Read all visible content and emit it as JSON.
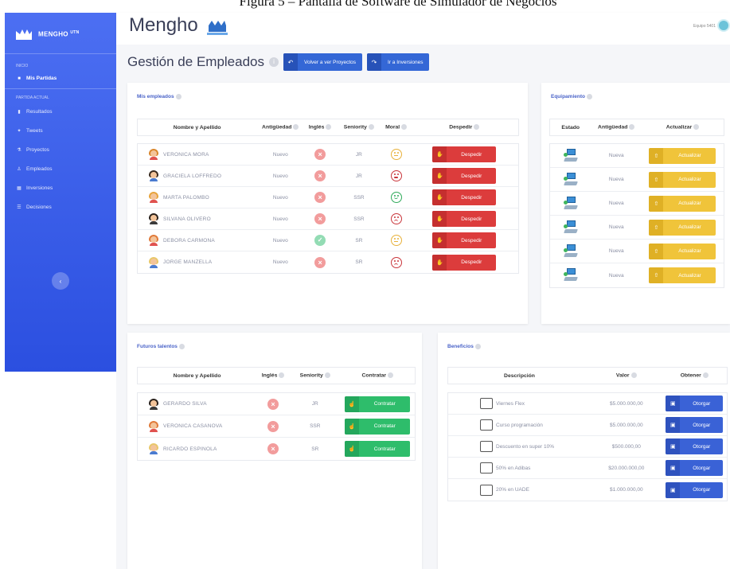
{
  "caption": "Figura 5 – Pantalla de Software de Simulador de Negocios",
  "sidebar": {
    "brand": "MENGHO",
    "brand_sup": "UTN",
    "section_inicio": "INICIO",
    "mis_partidas": "Mis Partidas",
    "section_partida": "PARTIDA ACTUAL",
    "items": [
      {
        "label": "Resultados",
        "icon": "chart-icon"
      },
      {
        "label": "Tweets",
        "icon": "twitter-icon"
      },
      {
        "label": "Proyectos",
        "icon": "flask-icon"
      },
      {
        "label": "Empleados",
        "icon": "user-icon"
      },
      {
        "label": "Inversiones",
        "icon": "grid-icon"
      },
      {
        "label": "Decisiones",
        "icon": "list-icon"
      }
    ]
  },
  "topbar": {
    "title": "Mengho",
    "user": "Equipo 5401"
  },
  "page": {
    "title": "Gestión de Empleados",
    "btn_back": "Volver a ver Proyectos",
    "btn_invest": "Ir a Inversiones"
  },
  "empleados": {
    "title": "Mis empleados",
    "headers": [
      "Nombre y Apellido",
      "Antigüedad",
      "Inglés",
      "Seniority",
      "Moral",
      "Despedir"
    ],
    "action_label": "Despedir",
    "rows": [
      {
        "name": "VERONICA MORA",
        "antiguedad": "Nuevo",
        "ingles": false,
        "seniority": "JR",
        "moral": "neutral"
      },
      {
        "name": "GRACIELA LOFFREDO",
        "antiguedad": "Nuevo",
        "ingles": false,
        "seniority": "JR",
        "moral": "angry"
      },
      {
        "name": "MARTA PALOMBO",
        "antiguedad": "Nuevo",
        "ingles": false,
        "seniority": "SSR",
        "moral": "happy"
      },
      {
        "name": "SILVANA OLIVERO",
        "antiguedad": "Nuevo",
        "ingles": false,
        "seniority": "SSR",
        "moral": "sad"
      },
      {
        "name": "DEBORA CARMONA",
        "antiguedad": "Nuevo",
        "ingles": true,
        "seniority": "SR",
        "moral": "neutral"
      },
      {
        "name": "JORGE MANZELLA",
        "antiguedad": "Nuevo",
        "ingles": false,
        "seniority": "SR",
        "moral": "sad"
      }
    ]
  },
  "equipamiento": {
    "title": "Equipamiento",
    "headers": [
      "Estado",
      "Antigüedad",
      "Actualizar"
    ],
    "action_label": "Actualizar",
    "rows": [
      {
        "antiguedad": "Nueva"
      },
      {
        "antiguedad": "Nueva"
      },
      {
        "antiguedad": "Nueva"
      },
      {
        "antiguedad": "Nueva"
      },
      {
        "antiguedad": "Nueva"
      },
      {
        "antiguedad": "Nueva"
      }
    ]
  },
  "talentos": {
    "title": "Futuros talentos",
    "headers": [
      "Nombre y Apellido",
      "Inglés",
      "Seniority",
      "Contratar"
    ],
    "action_label": "Contratar",
    "rows": [
      {
        "name": "GERARDO SILVA",
        "seniority": "JR"
      },
      {
        "name": "VERONICA CASANOVA",
        "seniority": "SSR"
      },
      {
        "name": "RICARDO ESPINOLA",
        "seniority": "SR"
      }
    ]
  },
  "beneficios": {
    "title": "Beneficios",
    "headers": [
      "Descripción",
      "Valor",
      "Obtener"
    ],
    "action_label": "Otorgar",
    "rows": [
      {
        "desc": "Viernes Flex",
        "valor": "$5.000.000,00"
      },
      {
        "desc": "Curso programación",
        "valor": "$5.000.000,00"
      },
      {
        "desc": "Descuento en super 10%",
        "valor": "$500.000,00"
      },
      {
        "desc": "50% en Adibas",
        "valor": "$20.000.000,00"
      },
      {
        "desc": "20% en UADE",
        "valor": "$1.000.000,00"
      }
    ]
  },
  "colors": {
    "primary": "#3467d6",
    "danger": "#dc3c3c",
    "warning": "#f0c43a",
    "success": "#2ebd6b",
    "sidebar": "#3a5ce8"
  }
}
